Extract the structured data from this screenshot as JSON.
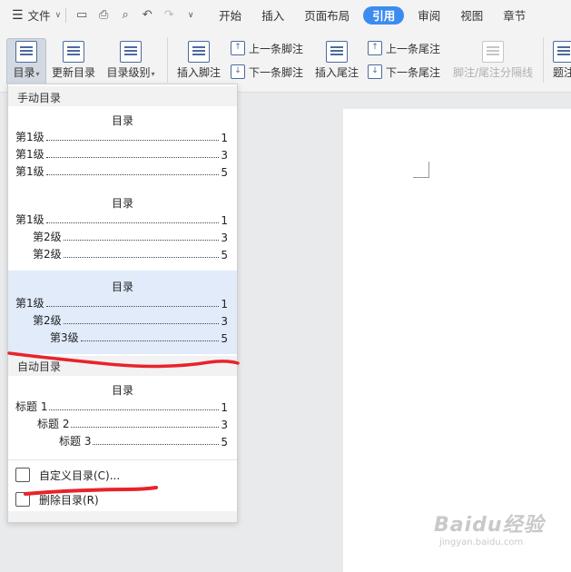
{
  "menubar": {
    "file_label": "文件",
    "tabs": [
      "开始",
      "插入",
      "页面布局",
      "引用",
      "审阅",
      "视图",
      "章节"
    ],
    "active_tab": "引用"
  },
  "ribbon": {
    "toc_button": "目录",
    "update_toc": "更新目录",
    "toc_level": "目录级别",
    "insert_footnote": "插入脚注",
    "prev_footnote": "上一条脚注",
    "next_footnote": "下一条脚注",
    "insert_endnote": "插入尾注",
    "prev_endnote": "上一条尾注",
    "next_endnote": "下一条尾注",
    "footnote_separator": "脚注/尾注分隔线",
    "caption_partial": "题注"
  },
  "dropdown": {
    "manual_header": "手动目录",
    "auto_header": "自动目录",
    "tocs": [
      {
        "title": "目录",
        "lines": [
          {
            "text": "第1级",
            "page": "1"
          },
          {
            "text": "第1级",
            "page": "3"
          },
          {
            "text": "第1级",
            "page": "5"
          }
        ]
      },
      {
        "title": "目录",
        "lines": [
          {
            "text": "第1级",
            "page": "1"
          },
          {
            "text": "第2级",
            "page": "3"
          },
          {
            "text": "第2级",
            "page": "5"
          }
        ]
      },
      {
        "title": "目录",
        "lines": [
          {
            "text": "第1级",
            "page": "1"
          },
          {
            "text": "第2级",
            "page": "3"
          },
          {
            "text": "第3级",
            "page": "5"
          }
        ]
      },
      {
        "title": "目录",
        "lines": [
          {
            "text": "标题 1",
            "page": "1"
          },
          {
            "text": "标题 2",
            "page": "3"
          },
          {
            "text": "标题 3",
            "page": "5"
          }
        ]
      }
    ],
    "custom_toc": "自定义目录(C)...",
    "delete_toc": "删除目录(R)"
  },
  "watermark": {
    "brand": "Baidu经验",
    "url": "jingyan.baidu.com"
  },
  "colors": {
    "active_tab": "#3c8cf0",
    "highlight": "#e1ebfa",
    "annotation": "#e8232a"
  }
}
